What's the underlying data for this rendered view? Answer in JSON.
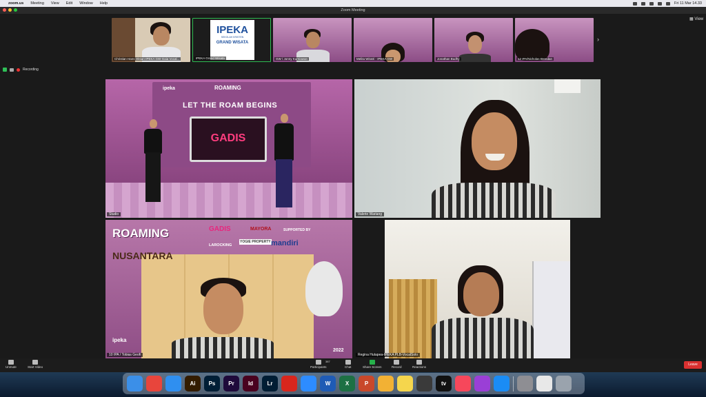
{
  "menubar": {
    "app_name": "zoom.us",
    "items": [
      "Meeting",
      "View",
      "Edit",
      "Window",
      "Help"
    ],
    "clock": "Fri 11 Mar 14.33"
  },
  "window": {
    "title": "Zoom Meeting"
  },
  "view_button": "View",
  "recording_label": "Recording",
  "strip": [
    {
      "name": "Christian Hans Oktian-IPEKA GW-Gaia Vocal..."
    },
    {
      "name": "IPEKA Grand Wisata",
      "logo_top": "IPEKA",
      "logo_mid": "SEKOLAH KRISTEN",
      "logo_bottom": "GRAND WISATA"
    },
    {
      "name": "GW / Jonny Kurniawan"
    },
    {
      "name": "Melita Wiratri - IPEKA GW"
    },
    {
      "name": "Jonathan Budhy"
    },
    {
      "name": "12 IPA/Nicholas Brendan"
    }
  ],
  "tiles": {
    "studio": {
      "name": "Studio",
      "banner": "LET THE ROAM BEGINS",
      "logo": "ROAMING",
      "screen_text": "GADIS",
      "school": "ipeka"
    },
    "valerie": {
      "name": "Valerie Wariang"
    },
    "tobias": {
      "name": "10 IPA / Tobias Geofi",
      "title_1": "ROAMING",
      "title_2": "NUSANTARA",
      "sponsor_1": "GADIS",
      "sponsor_2": "MAYORA",
      "sponsor_3": "SUPPORTED BY",
      "sponsor_4": "LAROCKING",
      "sponsor_5": "YOGIE PROPERTY",
      "sponsor_6": "mandiri",
      "school": "ipeka",
      "year": "2022"
    },
    "regina": {
      "name": "Regina Hutapea-IPEKA PLB-VocalSolo"
    }
  },
  "toolbar": {
    "unmute": "Unmute",
    "start_video": "Start Video",
    "participants": "Participants",
    "participants_count": "387",
    "chat": "Chat",
    "share_screen": "Share Screen",
    "record": "Record",
    "reactions": "Reactions",
    "leave": "Leave"
  },
  "dock": {
    "apps": [
      {
        "name": "finder",
        "label": "",
        "color": "#3b8fe8"
      },
      {
        "name": "chrome",
        "label": "",
        "color": "#e8453c"
      },
      {
        "name": "safari",
        "label": "",
        "color": "#2f8ff0"
      },
      {
        "name": "illustrator",
        "label": "Ai",
        "color": "#331c00"
      },
      {
        "name": "photoshop",
        "label": "Ps",
        "color": "#001e36"
      },
      {
        "name": "premiere",
        "label": "Pr",
        "color": "#1f0a3b"
      },
      {
        "name": "indesign",
        "label": "Id",
        "color": "#49021f"
      },
      {
        "name": "lightroom",
        "label": "Lr",
        "color": "#001d34"
      },
      {
        "name": "acrobat",
        "label": "",
        "color": "#d8261d"
      },
      {
        "name": "zoom",
        "label": "",
        "color": "#2d8cff"
      },
      {
        "name": "word",
        "label": "W",
        "color": "#1f5bb5"
      },
      {
        "name": "excel",
        "label": "X",
        "color": "#1d7044"
      },
      {
        "name": "powerpoint",
        "label": "P",
        "color": "#c9482a"
      },
      {
        "name": "photos",
        "label": "",
        "color": "#f2b134"
      },
      {
        "name": "notes",
        "label": "",
        "color": "#f5d64d"
      },
      {
        "name": "quicktime",
        "label": "",
        "color": "#3a3a3a"
      },
      {
        "name": "tv",
        "label": "tv",
        "color": "#111111"
      },
      {
        "name": "music",
        "label": "",
        "color": "#f6475b"
      },
      {
        "name": "podcasts",
        "label": "",
        "color": "#9a3fd6"
      },
      {
        "name": "app-store",
        "label": "",
        "color": "#1a8cf5"
      },
      {
        "name": "system-preferences",
        "label": "",
        "color": "#8e8e93"
      }
    ]
  },
  "colors": {
    "accent": "#2d8cff",
    "leave": "#d93030",
    "share": "#26b14a",
    "studio_pink": "#a8589c",
    "rec": "#e33333"
  }
}
